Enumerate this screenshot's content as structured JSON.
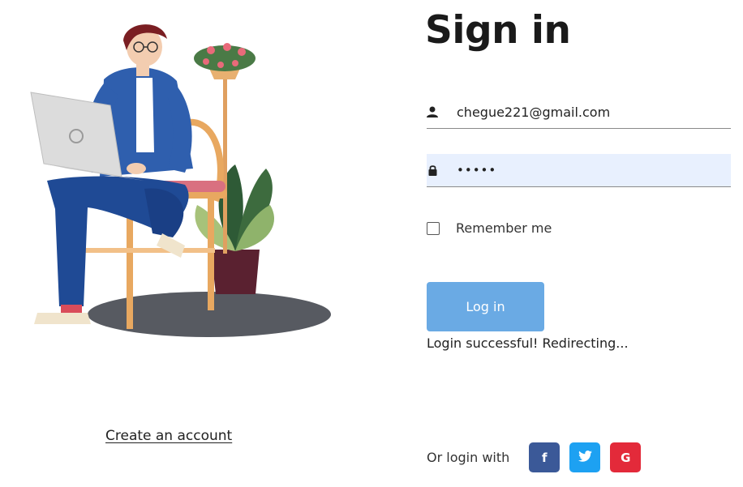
{
  "title": "Sign in",
  "email": {
    "value": "chegue221@gmail.com",
    "icon": "person-icon"
  },
  "password": {
    "value": "•••••",
    "icon": "lock-icon"
  },
  "remember": {
    "label": "Remember me",
    "checked": false
  },
  "login_button": "Log in",
  "status_message": "Login successful! Redirecting...",
  "create_account": "Create an account",
  "social": {
    "label": "Or login with",
    "buttons": [
      {
        "icon": "facebook-icon",
        "glyph": "f",
        "color": "#3b5998"
      },
      {
        "icon": "twitter-icon",
        "glyph": "t",
        "color": "#1da1f2"
      },
      {
        "icon": "google-icon",
        "glyph": "G",
        "color": "#e32a3a"
      }
    ]
  },
  "colors": {
    "button": "#6aaae4",
    "autofill": "#e8f0fe"
  }
}
